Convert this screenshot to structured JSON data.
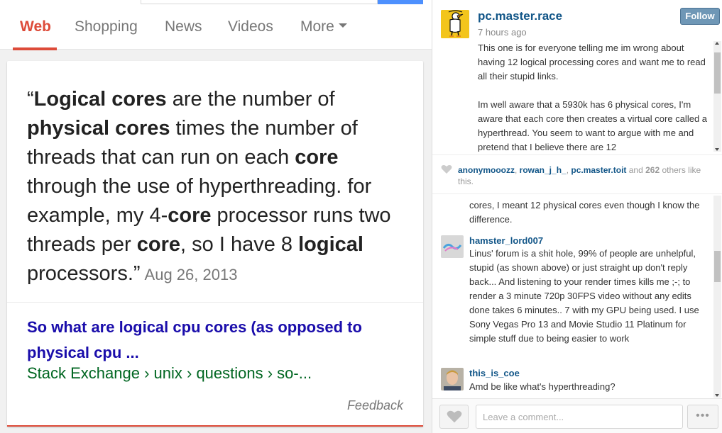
{
  "search": {
    "tabs": [
      {
        "label": "Web",
        "active": true
      },
      {
        "label": "Shopping",
        "active": false
      },
      {
        "label": "News",
        "active": false
      },
      {
        "label": "Videos",
        "active": false
      },
      {
        "label": "More",
        "active": false
      }
    ],
    "snippet": {
      "open_quote": "“",
      "q1": "Logical cores",
      "q2": " are the number of ",
      "q3": "physical cores",
      "q4": " times the number of threads that can run on each ",
      "q5": "core",
      "q6": " through the use of hyperthreading. for example, my 4-",
      "q7": "core",
      "q8": " processor runs two threads per ",
      "q9": "core",
      "q10": ", so I have 8 ",
      "q11": "logical",
      "q12": " processors.”",
      "date": "Aug 26, 2013"
    },
    "result": {
      "title": "So what are logical cpu cores (as opposed to physical cpu ...",
      "url": "Stack Exchange › unix › questions › so-..."
    },
    "feedback": "Feedback",
    "colors": {
      "accent": "#dd4b39",
      "link": "#1a0dab",
      "url": "#006621"
    }
  },
  "post": {
    "username": "pc.master.race",
    "time": "7 hours ago",
    "follow_label": "Follow",
    "caption": [
      "This one is for everyone telling me im wrong about having 12 logical processing cores and want me to read all their stupid links.",
      "Im well aware that a 5930k has 6 physical cores, I'm aware that each core then creates a virtual core called a hyperthread. You seem to want to argue with me and pretend that I believe there are 12"
    ],
    "likes": {
      "users": [
        "anonymooozz",
        "rowan_j_h_",
        "pc.master.toit"
      ],
      "sep1": ", ",
      "sep2": ", ",
      "and_text": " and ",
      "count": "262",
      "suffix": " others like this."
    },
    "comments": [
      {
        "user": "",
        "text": "cores, I meant 12 physical cores even though I know the difference."
      },
      {
        "user": "hamster_lord007",
        "text": "Linus' forum is a shit hole, 99% of people are unhelpful, stupid (as shown above) or just straight up don't reply back... And listening to your render times kills me ;-; to render a 3 minute 720p 30FPS video without any edits done takes 6 minutes.. 7 with my GPU being used. I use Sony Vegas Pro 13 and Movie Studio 11 Platinum for simple stuff due to being easier to work"
      },
      {
        "user": "this_is_coe",
        "text": "Amd be like what's hyperthreading?"
      }
    ],
    "comment_placeholder": "Leave a comment...",
    "more_label": "•••",
    "colors": {
      "username": "#125688",
      "follow_bg": "#6f97b6",
      "avatar_bg": "#f3c51c"
    }
  }
}
